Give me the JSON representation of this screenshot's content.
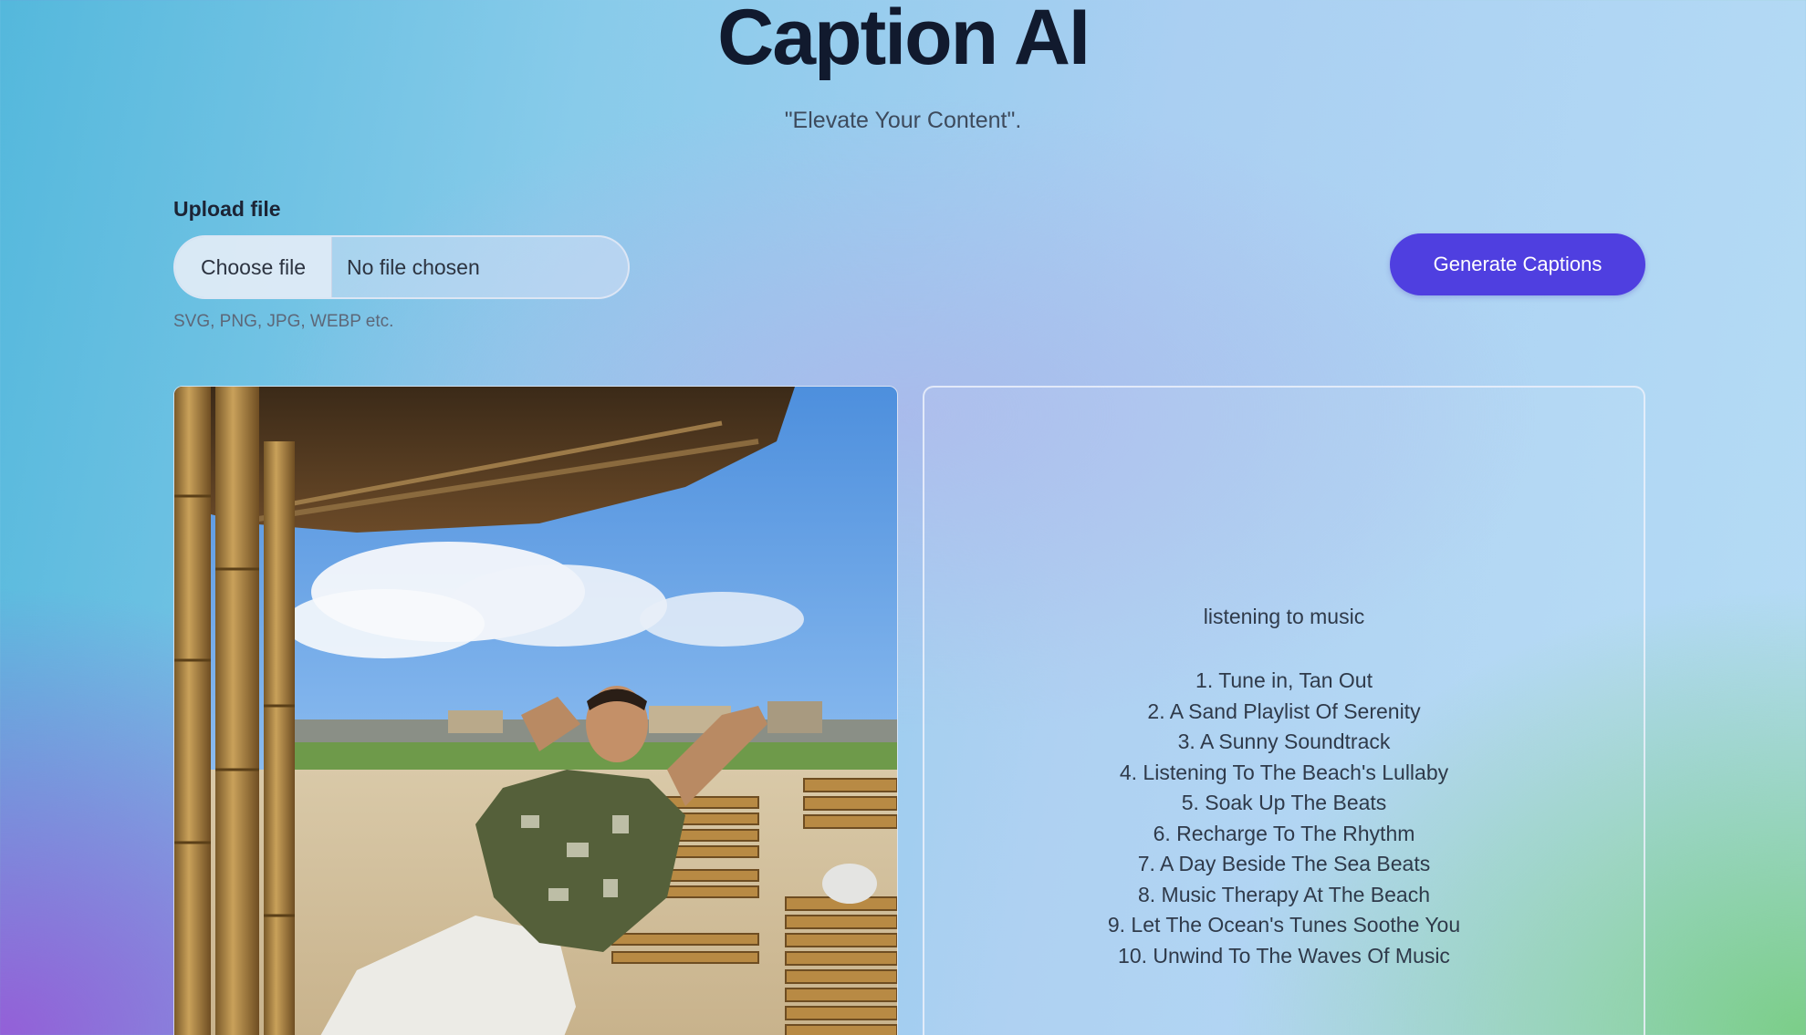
{
  "header": {
    "title": "Caption AI",
    "tagline": "\"Elevate Your Content\"."
  },
  "upload": {
    "label": "Upload file",
    "choose_button": "Choose file",
    "status": "No file chosen",
    "hint": "SVG, PNG, JPG, WEBP etc."
  },
  "actions": {
    "generate_label": "Generate Captions",
    "accent_color": "#4f3fe0"
  },
  "preview": {
    "icon": "uploaded-photo"
  },
  "captions": {
    "theme": "listening to music",
    "items": [
      "1. Tune in, Tan Out",
      "2. A Sand Playlist Of Serenity",
      "3. A Sunny Soundtrack",
      "4. Listening To The Beach's Lullaby",
      "5. Soak Up The Beats",
      "6. Recharge To The Rhythm",
      "7. A Day Beside The Sea Beats",
      "8. Music Therapy At The Beach",
      "9. Let The Ocean's Tunes Soothe You",
      "10. Unwind To The Waves Of Music"
    ]
  }
}
